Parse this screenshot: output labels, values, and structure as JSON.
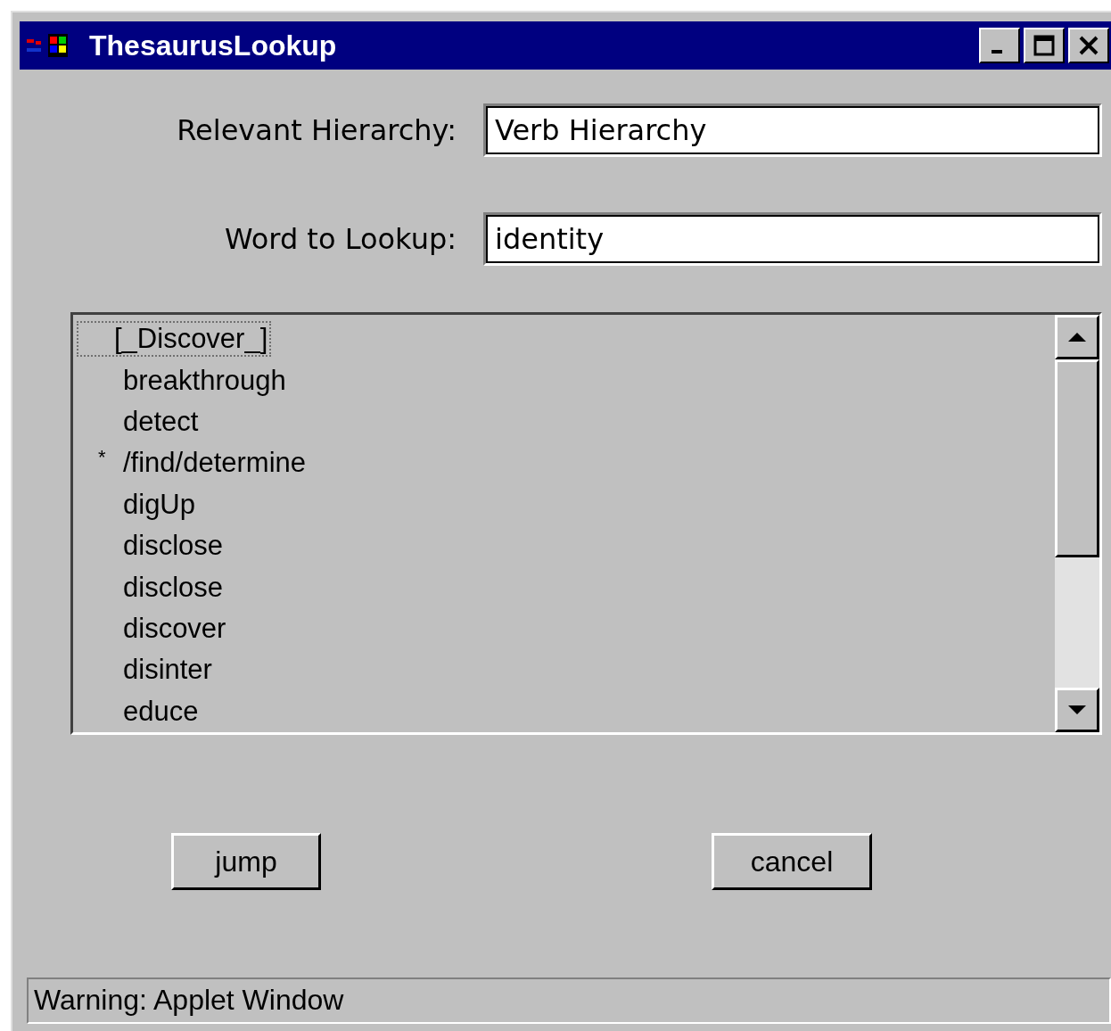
{
  "window": {
    "title": "ThesaurusLookup"
  },
  "fields": [
    {
      "label": "Relevant Hierarchy:",
      "value": "Verb Hierarchy"
    },
    {
      "label": "Word to Lookup:",
      "value": "identity"
    }
  ],
  "list": {
    "items": [
      {
        "text": "[_Discover_]",
        "selected": true
      },
      {
        "text": "breakthrough",
        "selected": false
      },
      {
        "text": "detect",
        "selected": false
      },
      {
        "text": "/find/determine",
        "mark": "*",
        "selected": false
      },
      {
        "text": "digUp",
        "selected": false
      },
      {
        "text": "disclose",
        "selected": false
      },
      {
        "text": "disclose",
        "selected": false
      },
      {
        "text": "discover",
        "selected": false
      },
      {
        "text": "disinter",
        "selected": false
      },
      {
        "text": "educe",
        "selected": false
      }
    ]
  },
  "buttons": [
    "jump",
    "cancel"
  ],
  "status_bar": "Warning: Applet Window"
}
